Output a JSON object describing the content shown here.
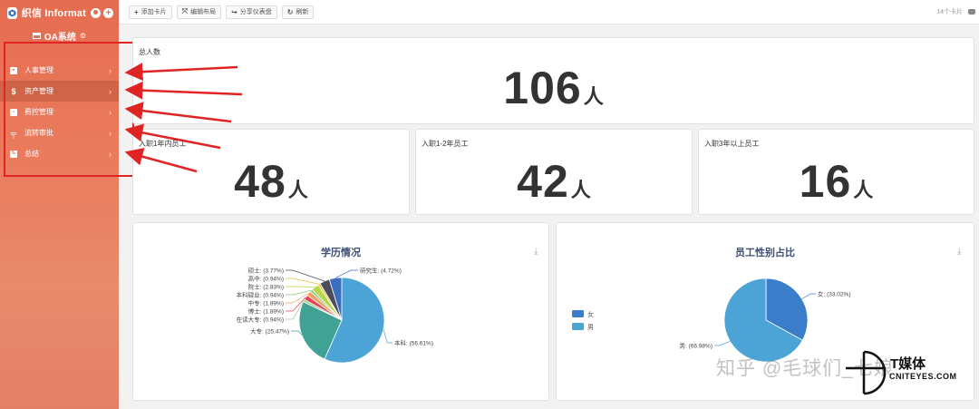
{
  "app": {
    "name": "织信 Informat",
    "system": "OA系统"
  },
  "menu": [
    {
      "label": "人事管理",
      "icon": "person-card-icon"
    },
    {
      "label": "资产管理",
      "icon": "dollar-icon"
    },
    {
      "label": "费控管理",
      "icon": "money-icon"
    },
    {
      "label": "流转审批",
      "icon": "flow-icon"
    },
    {
      "label": "总结",
      "icon": "edit-icon"
    }
  ],
  "toolbar": {
    "add_card": "添加卡片",
    "edit_layout": "编辑布局",
    "share": "分享仪表盘",
    "refresh": "刷新",
    "card_count": "14个卡片"
  },
  "stats": {
    "total": {
      "label": "总人数",
      "value": "106",
      "unit": "人"
    },
    "one_year": {
      "label": "入职1年内员工",
      "value": "48",
      "unit": "人"
    },
    "one_two": {
      "label": "入职1-2年员工",
      "value": "42",
      "unit": "人"
    },
    "three_plus": {
      "label": "入职3年以上员工",
      "value": "16",
      "unit": "人"
    }
  },
  "chart_data": [
    {
      "type": "pie",
      "title": "学历情况",
      "slices": [
        {
          "label": "本科",
          "value": 56.61,
          "color": "#4ba3d6",
          "text": "本科: (56.61%)"
        },
        {
          "label": "大专",
          "value": 25.47,
          "color": "#40a195",
          "text": "大专: (25.47%)"
        },
        {
          "label": "在读大专",
          "value": 0.94,
          "color": "#9bd17d",
          "text": "在读大专: (0.94%)"
        },
        {
          "label": "博士",
          "value": 1.89,
          "color": "#e2445c",
          "text": "博士: (1.89%)"
        },
        {
          "label": "中专",
          "value": 1.89,
          "color": "#f0a060",
          "text": "中专: (1.89%)"
        },
        {
          "label": "本科肄业",
          "value": 0.94,
          "color": "#7fc97f",
          "text": "本科肄业: (0.94%)"
        },
        {
          "label": "院士",
          "value": 2.83,
          "color": "#b5d94a",
          "text": "院士: (2.83%)"
        },
        {
          "label": "高中",
          "value": 0.94,
          "color": "#e8c040",
          "text": "高中: (0.94%)"
        },
        {
          "label": "硕士",
          "value": 3.77,
          "color": "#4c4c5c",
          "text": "硕士: (3.77%)"
        },
        {
          "label": "研究生",
          "value": 4.72,
          "color": "#3a6ec0",
          "text": "研究生: (4.72%)"
        }
      ]
    },
    {
      "type": "pie",
      "title": "员工性别占比",
      "legend": [
        "女",
        "男"
      ],
      "slices": [
        {
          "label": "女",
          "value": 33.02,
          "color": "#3a7dc9",
          "text": "女: (33.02%)"
        },
        {
          "label": "男",
          "value": 66.98,
          "color": "#4ba3d6",
          "text": "男: (66.98%)"
        }
      ]
    }
  ],
  "watermark": {
    "zhihu": "知乎 @毛球们_七娘",
    "brand": "T媒体",
    "brand_sub": "CNITEYES.COM"
  }
}
